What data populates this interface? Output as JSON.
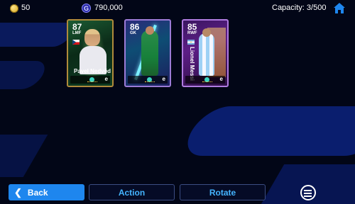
{
  "topbar": {
    "coins": "50",
    "gp_icon": "G",
    "gp": "790,000",
    "capacity": "Capacity: 3/500"
  },
  "cards": [
    {
      "rating": "87",
      "position": "LMF",
      "name": "Pavel Nedvěd",
      "nationality_flag": "czech-flag-icon",
      "border_color": "#b08b3b"
    },
    {
      "rating": "86",
      "position": "GK",
      "name": "",
      "nationality_flag": "",
      "border_color": "#9c7bd6"
    },
    {
      "rating": "85",
      "position": "RWF",
      "name": "Lionel Messi",
      "nationality_flag": "argentina-flag-icon",
      "border_color": "#b07be0"
    }
  ],
  "card_brand": "e",
  "buttons": {
    "back": "Back",
    "action": "Action",
    "rotate": "Rotate"
  },
  "colors": {
    "back_button": "#1e86ee",
    "secondary_text": "#44b4ff",
    "home_icon": "#1e86ee"
  }
}
